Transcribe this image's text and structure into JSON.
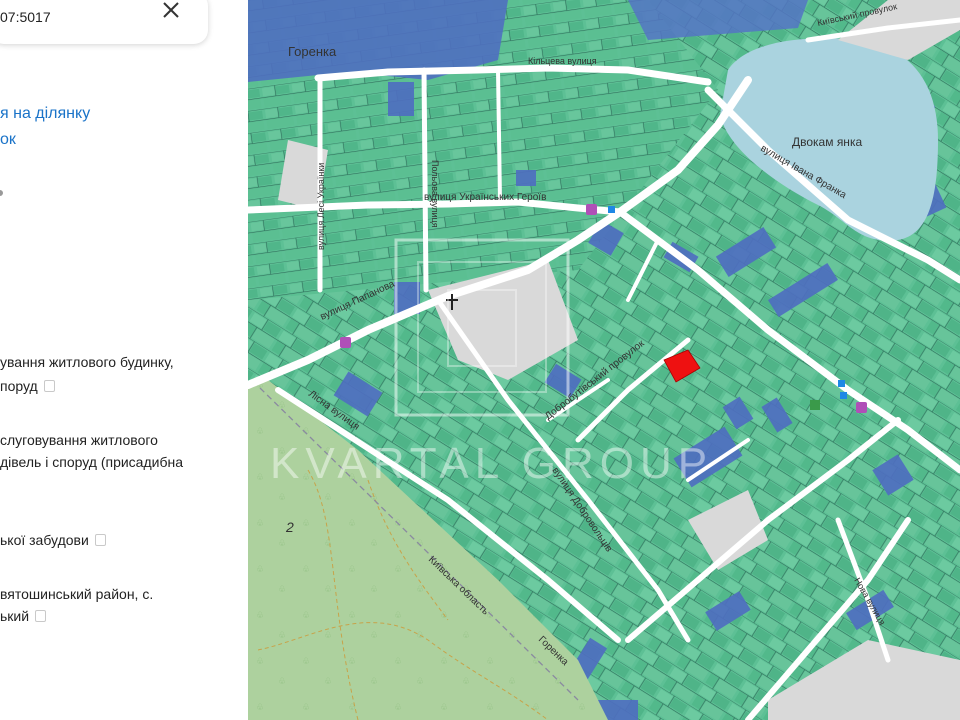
{
  "panel": {
    "cadastral_number": "07:5017",
    "link": {
      "line1": "я на ділянку",
      "line2": "ок"
    },
    "purpose": {
      "line1": "ування житлового будинку,",
      "line2": "поруд"
    },
    "purpose_full": {
      "line1": "слуговування житлового",
      "line2": "дівель і споруд (присадибна"
    },
    "category": "ької забудови",
    "address": {
      "line1": "вятошинський район, с.",
      "line2": "ький"
    }
  },
  "map": {
    "streets": [
      {
        "name": "вулиця Папанова",
        "name_svg": "street-papanova"
      },
      {
        "name": "вулиця Українських Героїв",
        "name_svg": "street-ukr-heroiv"
      },
      {
        "name": "вулиця Лесі Українки",
        "name_svg": "street-lesi-ukrainky"
      },
      {
        "name": "Польова вулиця",
        "name_svg": "street-polova"
      },
      {
        "name": "Кільцева вулиця",
        "name_svg": "street-kiltseva"
      },
      {
        "name": "Лісна вулиця",
        "name_svg": "street-lisna"
      },
      {
        "name": "Добробутівський провулок",
        "name_svg": "street-dobrobutivskyi"
      },
      {
        "name": "вулиця Добровольців",
        "name_svg": "street-dobrovoltsiv"
      },
      {
        "name": "вулиця Івана Франка",
        "name_svg": "street-ivana-franka"
      },
      {
        "name": "Київський провулок",
        "name_svg": "street-kyivskyi"
      },
      {
        "name": "Нова вулиця",
        "name_svg": "street-nova"
      }
    ],
    "place_labels": {
      "village": "Горенка",
      "lake": "Двокам янка",
      "forest_number": "2",
      "region": "Київська область",
      "region_b": "Горенка"
    },
    "watermark": "KVARTAL GROUP",
    "colors": {
      "parcel": "#5dc095",
      "parcel_dark": "#3f9a7c",
      "parcel_blue": "#4f6fc0",
      "selected": "#ee1111",
      "water": "#aad3df",
      "forest": "#add19e"
    }
  }
}
